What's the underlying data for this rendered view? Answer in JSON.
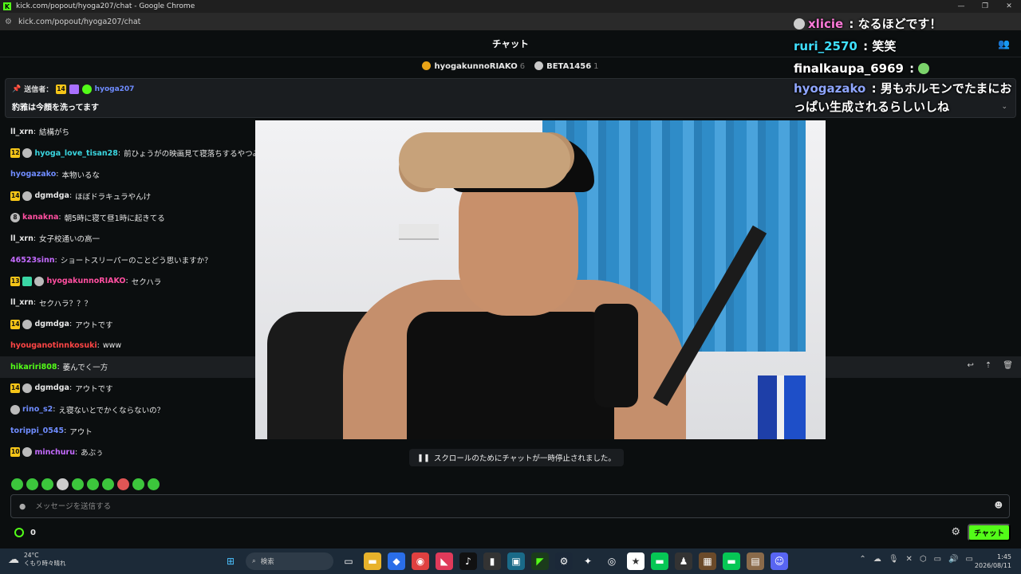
{
  "browser": {
    "favicon": "K",
    "title": "kick.com/popout/hyoga207/chat - Google Chrome",
    "url": "kick.com/popout/hyoga207/chat",
    "controls": [
      "—",
      "❐",
      "✕"
    ]
  },
  "chat": {
    "title": "チャット",
    "leaderboard": [
      {
        "name": "hyogakunnoRIAKO",
        "count": "6"
      },
      {
        "name": "BETA1456",
        "count": "1"
      }
    ],
    "pinned": {
      "label": "送信者：",
      "badge": "14",
      "user": "hyoga207",
      "text": "豹雅は今顔を洗ってます"
    },
    "messages": [
      {
        "badges": [],
        "user": "ll_xrn",
        "color": "#e6e6e6",
        "text": "結構がち"
      },
      {
        "badges": [
          "12",
          "g"
        ],
        "user": "hyoga_love_tisan28",
        "color": "#3ad6e0",
        "text": "前ひょうがの映画見て寝落ちするやつみて…"
      },
      {
        "badges": [],
        "user": "hyogazako",
        "color": "#6f8cff",
        "text": "本物いるな"
      },
      {
        "badges": [
          "14",
          "g"
        ],
        "user": "dgmdga",
        "color": "#e6e6e6",
        "text": "ほぼドラキュラやんけ"
      },
      {
        "badges": [
          "8"
        ],
        "user": "kanakna",
        "color": "#ff4fa0",
        "text": "朝5時に寝て昼1時に起きてる"
      },
      {
        "badges": [],
        "user": "ll_xrn",
        "color": "#e6e6e6",
        "text": "女子校通いの高一"
      },
      {
        "badges": [],
        "user": "46523sinn",
        "color": "#c46bff",
        "text": "ショートスリーパーのことどう思いますか？"
      },
      {
        "badges": [
          "13",
          "m",
          "g"
        ],
        "user": "hyogakunnoRIAKO",
        "color": "#ff4fa0",
        "text": "セクハラ"
      },
      {
        "badges": [],
        "user": "ll_xrn",
        "color": "#e6e6e6",
        "text": "セクハラ？？？"
      },
      {
        "badges": [
          "14",
          "g"
        ],
        "user": "dgmdga",
        "color": "#e6e6e6",
        "text": "アウトです"
      },
      {
        "badges": [],
        "user": "hyouganotinnkosuki",
        "color": "#ff4545",
        "text": "www"
      },
      {
        "badges": [],
        "user": "hikariri808",
        "color": "#53fc18",
        "text": "萎んでく一方",
        "hl": true
      },
      {
        "badges": [
          "14",
          "g"
        ],
        "user": "dgmdga",
        "color": "#e6e6e6",
        "text": "アウトです"
      },
      {
        "badges": [
          "g"
        ],
        "user": "rino_s2",
        "color": "#6f8cff",
        "text": "え寝ないとでかくならないの？"
      },
      {
        "badges": [],
        "user": "torippi_0545",
        "color": "#6f8cff",
        "text": "アウト"
      },
      {
        "badges": [
          "10",
          "g"
        ],
        "user": "minchuru",
        "color": "#c46bff",
        "text": "あぶぅ"
      }
    ],
    "paused_notice": "スクロールのためにチャットが一時停止されました。",
    "input_placeholder": "メッセージを送信する",
    "points": "0",
    "send_label": "チャット"
  },
  "overlay": [
    {
      "user": "xlicie",
      "color": "#ff7ad9",
      "text": "なるほどです！"
    },
    {
      "user": "ruri_2570",
      "color": "#40e0ff",
      "text": "笑笑"
    },
    {
      "user": "finalkaupa_6969",
      "color": "#ffffff",
      "text": ""
    },
    {
      "user": "hyogazako",
      "color": "#8fa6ff",
      "text": "男もホルモンでたまにおっぱい生成されるらしいしね"
    }
  ],
  "taskbar": {
    "temp": "24°C",
    "weather": "くもり時々晴れ",
    "search": "検索",
    "time": "1:45",
    "date": "2026/08/11"
  },
  "colors": {
    "accent": "#53fc18",
    "bg": "#0b0e0f"
  }
}
